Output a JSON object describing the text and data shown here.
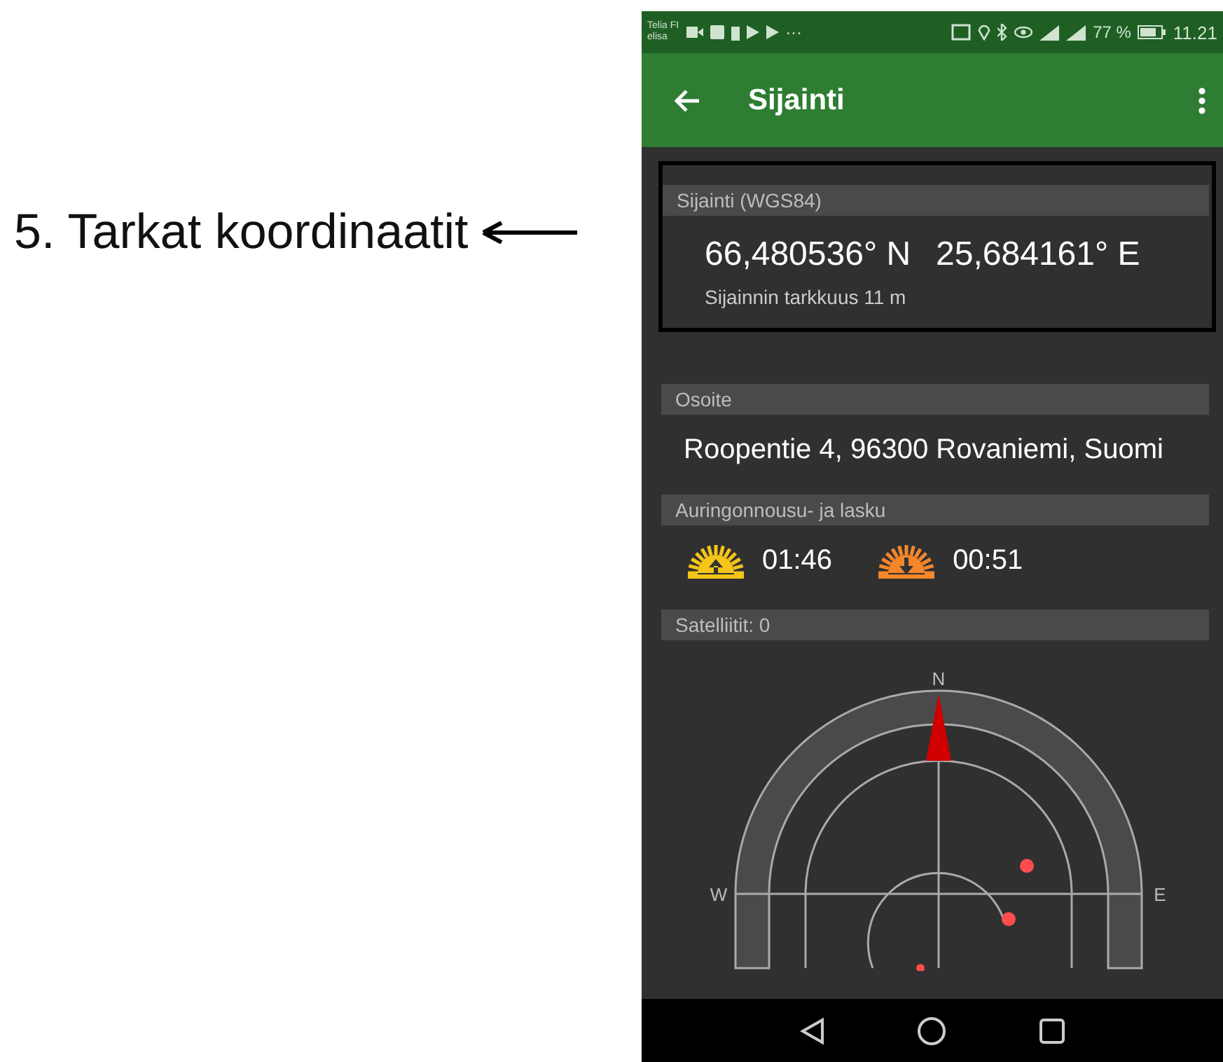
{
  "annotation": {
    "label": "5. Tarkat koordinaatit"
  },
  "status_bar": {
    "carriers": [
      "Telia FI",
      "elisa"
    ],
    "more": "···",
    "battery_percent": "77 %",
    "time": "11.21"
  },
  "app_bar": {
    "title": "Sijainti"
  },
  "sections": [
    {
      "kind": "coordinates",
      "header": "Sijainti (WGS84)",
      "highlighted": true,
      "latitude": "66,480536° N",
      "longitude": "25,684161° E",
      "accuracy": "Sijainnin tarkkuus 11 m"
    },
    {
      "kind": "address",
      "header": "Osoite",
      "value": "Roopentie 4, 96300 Rovaniemi, Suomi"
    },
    {
      "kind": "sun",
      "header": "Auringonnousu- ja lasku",
      "sunrise": "01:46",
      "sunset": "00:51"
    },
    {
      "kind": "satellites",
      "header": "Satelliitit: 0",
      "compass": {
        "north": "N",
        "west": "W",
        "east": "E"
      }
    }
  ]
}
